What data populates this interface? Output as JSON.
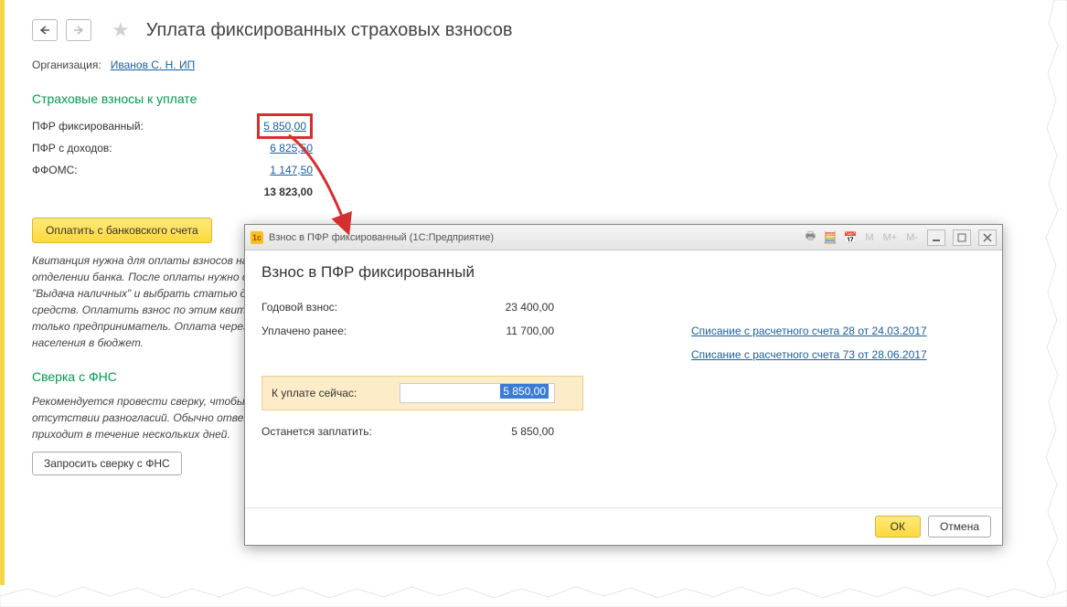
{
  "header": {
    "title": "Уплата фиксированных страховых взносов"
  },
  "organization": {
    "label": "Организация:",
    "value": "Иванов С. Н. ИП"
  },
  "contributions": {
    "heading": "Страховые взносы к уплате",
    "rows": [
      {
        "label": "ПФР фиксированный:",
        "value": "5 850,00",
        "highlight": true
      },
      {
        "label": "ПФР с доходов:",
        "value": "6 825,50"
      },
      {
        "label": "ФФОМС:",
        "value": "1 147,50"
      }
    ],
    "total": "13 823,00"
  },
  "pay_button": "Оплатить с банковского счета",
  "hint": "Квитанция нужна для оплаты взносов наличными в отделении банка. После оплаты нужно оформить документы \"Выдача наличных\" и выбрать статью движения денежных средств. Оплатить взнос по этим квитанциям может только предприниматель. Оплата через посредников от населения в бюджет.",
  "reconcile": {
    "heading": "Сверка с ФНС",
    "hint": "Рекомендуется провести сверку, чтобы убедиться в отсутствии разногласий. Обычно ответ на запрос сверки приходит в течение нескольких дней.",
    "button": "Запросить сверку с ФНС"
  },
  "modal": {
    "window_title": "Взнос в ПФР фиксированный  (1С:Предприятие)",
    "heading": "Взнос в ПФР фиксированный",
    "annual_label": "Годовой взнос:",
    "annual_value": "23 400,00",
    "paid_label": "Уплачено ранее:",
    "paid_value": "11 700,00",
    "links": [
      "Списание с расчетного счета 28 от 24.03.2017",
      "Списание с расчетного счета 73 от 28.06.2017"
    ],
    "due_now_label": "К уплате сейчас:",
    "due_now_value": "5 850,00",
    "remain_label": "Останется заплатить:",
    "remain_value": "5 850,00",
    "ok": "ОК",
    "cancel": "Отмена",
    "title_m": [
      "M",
      "M+",
      "M-"
    ]
  }
}
